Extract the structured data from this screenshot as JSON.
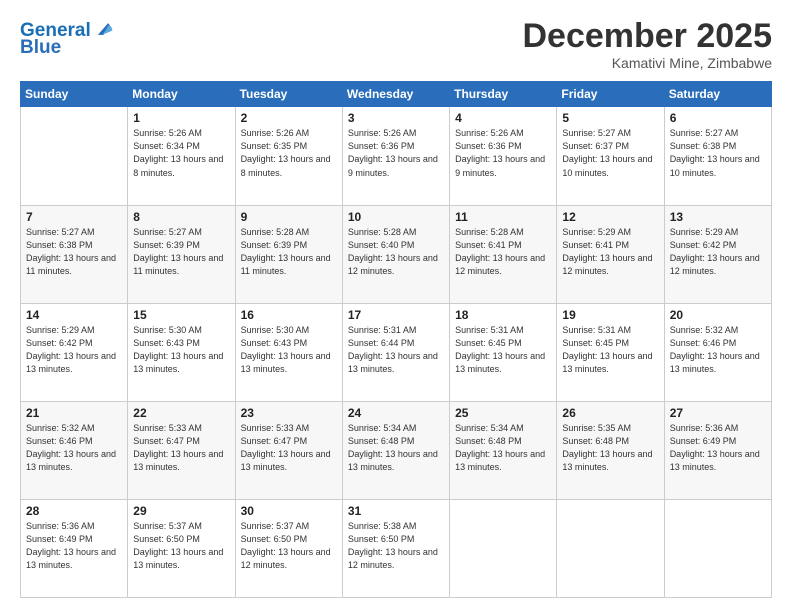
{
  "logo": {
    "line1": "General",
    "line2": "Blue"
  },
  "title": "December 2025",
  "location": "Kamativi Mine, Zimbabwe",
  "days_header": [
    "Sunday",
    "Monday",
    "Tuesday",
    "Wednesday",
    "Thursday",
    "Friday",
    "Saturday"
  ],
  "weeks": [
    [
      {
        "num": "",
        "sunrise": "",
        "sunset": "",
        "daylight": ""
      },
      {
        "num": "1",
        "sunrise": "Sunrise: 5:26 AM",
        "sunset": "Sunset: 6:34 PM",
        "daylight": "Daylight: 13 hours and 8 minutes."
      },
      {
        "num": "2",
        "sunrise": "Sunrise: 5:26 AM",
        "sunset": "Sunset: 6:35 PM",
        "daylight": "Daylight: 13 hours and 8 minutes."
      },
      {
        "num": "3",
        "sunrise": "Sunrise: 5:26 AM",
        "sunset": "Sunset: 6:36 PM",
        "daylight": "Daylight: 13 hours and 9 minutes."
      },
      {
        "num": "4",
        "sunrise": "Sunrise: 5:26 AM",
        "sunset": "Sunset: 6:36 PM",
        "daylight": "Daylight: 13 hours and 9 minutes."
      },
      {
        "num": "5",
        "sunrise": "Sunrise: 5:27 AM",
        "sunset": "Sunset: 6:37 PM",
        "daylight": "Daylight: 13 hours and 10 minutes."
      },
      {
        "num": "6",
        "sunrise": "Sunrise: 5:27 AM",
        "sunset": "Sunset: 6:38 PM",
        "daylight": "Daylight: 13 hours and 10 minutes."
      }
    ],
    [
      {
        "num": "7",
        "sunrise": "Sunrise: 5:27 AM",
        "sunset": "Sunset: 6:38 PM",
        "daylight": "Daylight: 13 hours and 11 minutes."
      },
      {
        "num": "8",
        "sunrise": "Sunrise: 5:27 AM",
        "sunset": "Sunset: 6:39 PM",
        "daylight": "Daylight: 13 hours and 11 minutes."
      },
      {
        "num": "9",
        "sunrise": "Sunrise: 5:28 AM",
        "sunset": "Sunset: 6:39 PM",
        "daylight": "Daylight: 13 hours and 11 minutes."
      },
      {
        "num": "10",
        "sunrise": "Sunrise: 5:28 AM",
        "sunset": "Sunset: 6:40 PM",
        "daylight": "Daylight: 13 hours and 12 minutes."
      },
      {
        "num": "11",
        "sunrise": "Sunrise: 5:28 AM",
        "sunset": "Sunset: 6:41 PM",
        "daylight": "Daylight: 13 hours and 12 minutes."
      },
      {
        "num": "12",
        "sunrise": "Sunrise: 5:29 AM",
        "sunset": "Sunset: 6:41 PM",
        "daylight": "Daylight: 13 hours and 12 minutes."
      },
      {
        "num": "13",
        "sunrise": "Sunrise: 5:29 AM",
        "sunset": "Sunset: 6:42 PM",
        "daylight": "Daylight: 13 hours and 12 minutes."
      }
    ],
    [
      {
        "num": "14",
        "sunrise": "Sunrise: 5:29 AM",
        "sunset": "Sunset: 6:42 PM",
        "daylight": "Daylight: 13 hours and 13 minutes."
      },
      {
        "num": "15",
        "sunrise": "Sunrise: 5:30 AM",
        "sunset": "Sunset: 6:43 PM",
        "daylight": "Daylight: 13 hours and 13 minutes."
      },
      {
        "num": "16",
        "sunrise": "Sunrise: 5:30 AM",
        "sunset": "Sunset: 6:43 PM",
        "daylight": "Daylight: 13 hours and 13 minutes."
      },
      {
        "num": "17",
        "sunrise": "Sunrise: 5:31 AM",
        "sunset": "Sunset: 6:44 PM",
        "daylight": "Daylight: 13 hours and 13 minutes."
      },
      {
        "num": "18",
        "sunrise": "Sunrise: 5:31 AM",
        "sunset": "Sunset: 6:45 PM",
        "daylight": "Daylight: 13 hours and 13 minutes."
      },
      {
        "num": "19",
        "sunrise": "Sunrise: 5:31 AM",
        "sunset": "Sunset: 6:45 PM",
        "daylight": "Daylight: 13 hours and 13 minutes."
      },
      {
        "num": "20",
        "sunrise": "Sunrise: 5:32 AM",
        "sunset": "Sunset: 6:46 PM",
        "daylight": "Daylight: 13 hours and 13 minutes."
      }
    ],
    [
      {
        "num": "21",
        "sunrise": "Sunrise: 5:32 AM",
        "sunset": "Sunset: 6:46 PM",
        "daylight": "Daylight: 13 hours and 13 minutes."
      },
      {
        "num": "22",
        "sunrise": "Sunrise: 5:33 AM",
        "sunset": "Sunset: 6:47 PM",
        "daylight": "Daylight: 13 hours and 13 minutes."
      },
      {
        "num": "23",
        "sunrise": "Sunrise: 5:33 AM",
        "sunset": "Sunset: 6:47 PM",
        "daylight": "Daylight: 13 hours and 13 minutes."
      },
      {
        "num": "24",
        "sunrise": "Sunrise: 5:34 AM",
        "sunset": "Sunset: 6:48 PM",
        "daylight": "Daylight: 13 hours and 13 minutes."
      },
      {
        "num": "25",
        "sunrise": "Sunrise: 5:34 AM",
        "sunset": "Sunset: 6:48 PM",
        "daylight": "Daylight: 13 hours and 13 minutes."
      },
      {
        "num": "26",
        "sunrise": "Sunrise: 5:35 AM",
        "sunset": "Sunset: 6:48 PM",
        "daylight": "Daylight: 13 hours and 13 minutes."
      },
      {
        "num": "27",
        "sunrise": "Sunrise: 5:36 AM",
        "sunset": "Sunset: 6:49 PM",
        "daylight": "Daylight: 13 hours and 13 minutes."
      }
    ],
    [
      {
        "num": "28",
        "sunrise": "Sunrise: 5:36 AM",
        "sunset": "Sunset: 6:49 PM",
        "daylight": "Daylight: 13 hours and 13 minutes."
      },
      {
        "num": "29",
        "sunrise": "Sunrise: 5:37 AM",
        "sunset": "Sunset: 6:50 PM",
        "daylight": "Daylight: 13 hours and 13 minutes."
      },
      {
        "num": "30",
        "sunrise": "Sunrise: 5:37 AM",
        "sunset": "Sunset: 6:50 PM",
        "daylight": "Daylight: 13 hours and 12 minutes."
      },
      {
        "num": "31",
        "sunrise": "Sunrise: 5:38 AM",
        "sunset": "Sunset: 6:50 PM",
        "daylight": "Daylight: 13 hours and 12 minutes."
      },
      {
        "num": "",
        "sunrise": "",
        "sunset": "",
        "daylight": ""
      },
      {
        "num": "",
        "sunrise": "",
        "sunset": "",
        "daylight": ""
      },
      {
        "num": "",
        "sunrise": "",
        "sunset": "",
        "daylight": ""
      }
    ]
  ]
}
